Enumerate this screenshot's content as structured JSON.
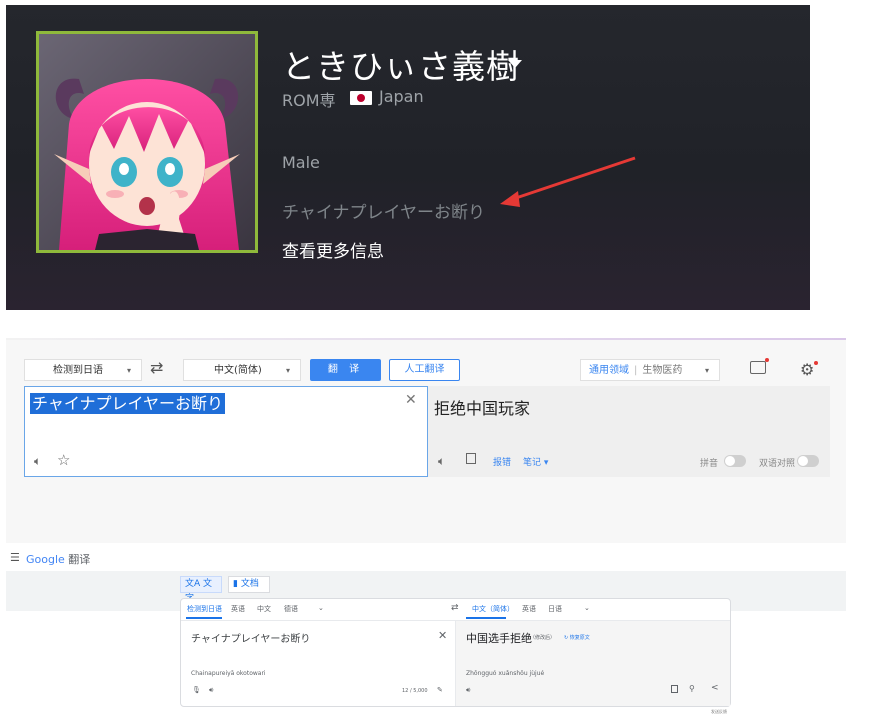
{
  "profile": {
    "name": "ときひぃさ義樹",
    "real_name": "ROM専",
    "country": "Japan",
    "gender": "Male",
    "summary": "チャイナプレイヤーお断り",
    "more_info": "查看更多信息",
    "frame_color": "#8fb93b",
    "arrow_color": "#e53935"
  },
  "youdao": {
    "source_lang": "检测到日语",
    "target_lang": "中文(简体)",
    "translate_button": "翻 译",
    "human_translate_button": "人工翻译",
    "domain_general": "通用领域",
    "domain_bio": "生物医药",
    "source_text": "チャイナプレイヤーお断り",
    "target_text": "拒绝中国玩家",
    "report": "报错",
    "notes": "笔记",
    "pinyin": "拼音",
    "bilingual": "双语对照",
    "accent": "#3a86f0"
  },
  "google": {
    "logo_google": "Google",
    "logo_translate": "翻译",
    "tab_text": "文字",
    "tab_docs": "文档",
    "src_langs": [
      "检测到日语",
      "英语",
      "中文",
      "德语"
    ],
    "tgt_langs": [
      "中文（简体）",
      "英语",
      "日语"
    ],
    "source_text": "チャイナプレイヤーお断り",
    "source_romanization": "Chainapureiyā okotowari",
    "char_count": "12 / 5,000",
    "target_text": "中国选手拒绝",
    "modified_tag": "（修改后）",
    "restore_original": "恢复原文",
    "target_romanization": "Zhōngguó xuǎnshǒu jùjué",
    "send_feedback": "发送反馈",
    "accent": "#1a73e8"
  }
}
